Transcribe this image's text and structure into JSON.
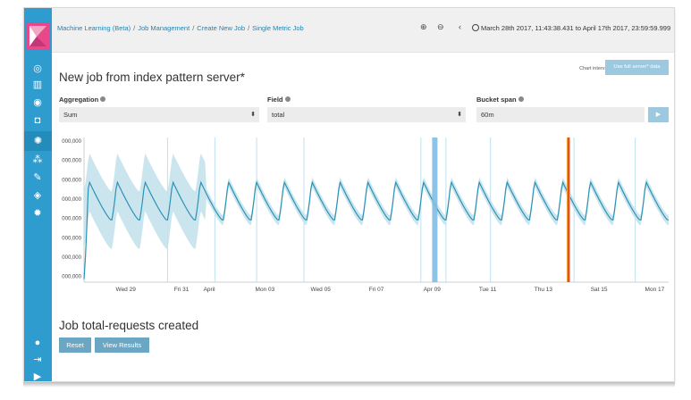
{
  "breadcrumbs": [
    "Machine Learning (Beta)",
    "Job Management",
    "Create New Job",
    "Single Metric Job"
  ],
  "time_range": "March 28th 2017, 11:43:38.431 to April 17th 2017, 23:59:59.999",
  "page_title": "New job from index pattern server*",
  "chart_interval": "Chart interval: 1h",
  "use_full_button": "Use full server* data",
  "aggregation": {
    "label": "Aggregation",
    "value": "Sum"
  },
  "field": {
    "label": "Field",
    "value": "total"
  },
  "bucket_span": {
    "label": "Bucket span",
    "value": "60m"
  },
  "run_icon": "play-icon",
  "job_created_title": "Job total-requests created",
  "reset_button": "Reset",
  "view_results_button": "View Results",
  "colors": {
    "sidebar": "#2e9ccf",
    "logo": "#e8488a",
    "series": "#2b93b5",
    "band": "#c5e2ec",
    "anomaly_high": "#e8472a",
    "anomaly_mid": "#f4b03c"
  },
  "chart_data": {
    "type": "line",
    "y_tick_labels": [
      "000,000",
      "000,000",
      "000,000",
      "000,000",
      "000,000",
      "000,000",
      "000,000",
      "000,000"
    ],
    "x_tick_labels": [
      "Wed 29",
      "Fri 31",
      "April",
      "Mon 03",
      "Wed 05",
      "Fri 07",
      "Apr 09",
      "Tue 11",
      "Thu 13",
      "Sat 15",
      "Mon 17"
    ],
    "x_tick_days": [
      1.5,
      3.5,
      4.5,
      6.5,
      8.5,
      10.5,
      12.5,
      14.5,
      16.5,
      18.5,
      20.5
    ],
    "days": 21,
    "period_days": 1,
    "series_level_min": 0.13,
    "series_level_max": 0.8,
    "anomaly_markers": [
      {
        "day": 12.6,
        "severity": "warning"
      },
      {
        "day": 17.4,
        "severity": "critical"
      }
    ]
  }
}
